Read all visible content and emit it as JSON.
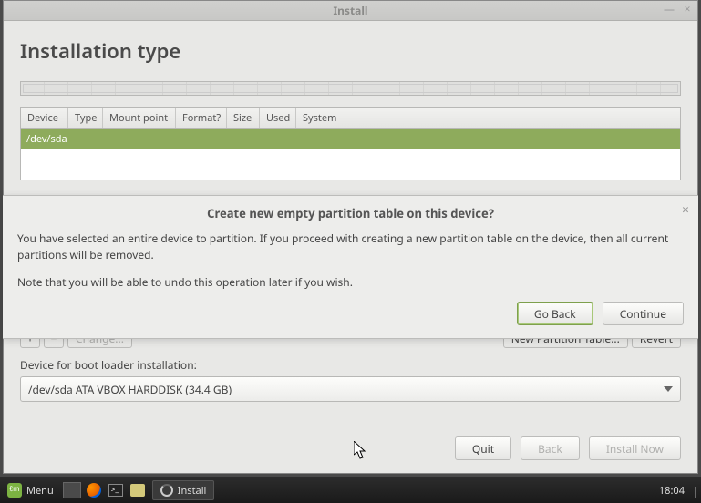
{
  "window": {
    "title": "Install"
  },
  "page": {
    "heading": "Installation type"
  },
  "table": {
    "headers": [
      "Device",
      "Type",
      "Mount point",
      "Format?",
      "Size",
      "Used",
      "System"
    ],
    "rows": [
      {
        "device": "/dev/sda"
      }
    ]
  },
  "toolbar": {
    "add": "+",
    "remove": "−",
    "change": "Change...",
    "new_table": "New Partition Table...",
    "revert": "Revert"
  },
  "bootloader": {
    "label": "Device for boot loader installation:",
    "selected": "/dev/sda ATA VBOX HARDDISK (34.4 GB)"
  },
  "footer": {
    "quit": "Quit",
    "back": "Back",
    "install": "Install Now"
  },
  "dialog": {
    "title": "Create new empty partition table on this device?",
    "line1": "You have selected an entire device to partition. If you proceed with creating a new partition table on the device, then all current partitions will be removed.",
    "line2": "Note that you will be able to undo this operation later if you wish.",
    "go_back": "Go Back",
    "continue": "Continue"
  },
  "taskbar": {
    "menu": "Menu",
    "active_task": "Install",
    "clock": "18:04"
  }
}
